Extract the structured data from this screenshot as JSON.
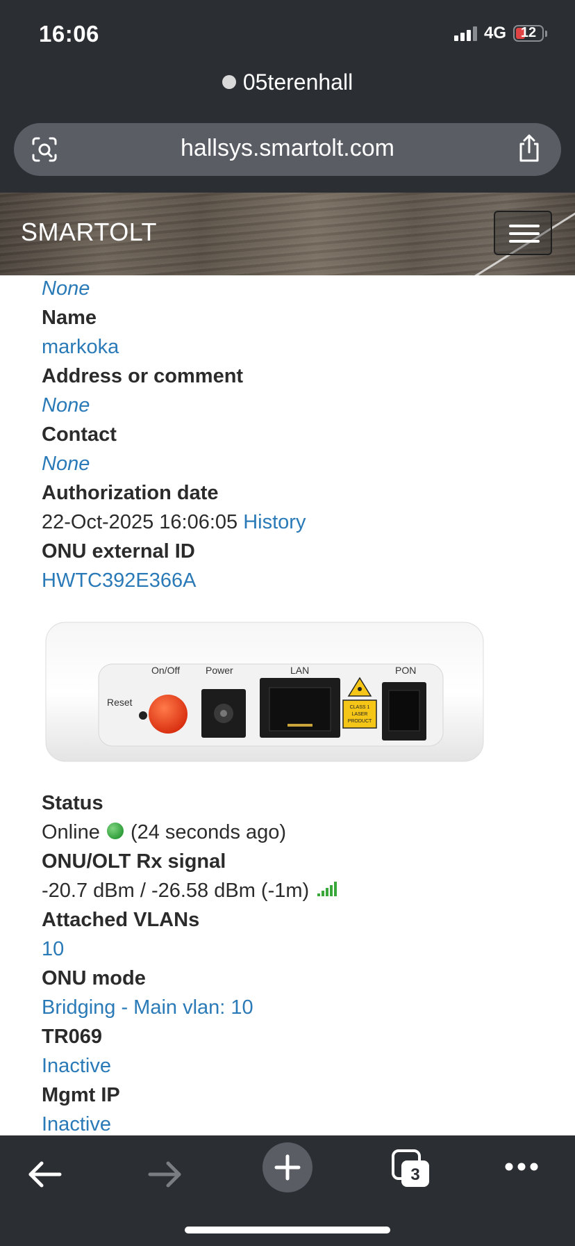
{
  "status_bar": {
    "time": "16:06",
    "network": "4G",
    "battery": "12"
  },
  "browser": {
    "site_name": "05terenhall",
    "url": "hallsys.smartolt.com",
    "tabs_count": "3"
  },
  "navbar": {
    "brand": "SMARTOLT"
  },
  "fields_top": {
    "prev_value": "None",
    "name_label": "Name",
    "name_value": "markoka",
    "address_label": "Address or comment",
    "address_value": "None",
    "contact_label": "Contact",
    "contact_value": "None",
    "auth_label": "Authorization date",
    "auth_value": "22-Oct-2025 16:06:05",
    "auth_history": "History",
    "ext_id_label": "ONU external ID",
    "ext_id_value": "HWTC392E366A"
  },
  "device_image": {
    "labels": {
      "reset": "Reset",
      "onoff": "On/Off",
      "power": "Power",
      "lan": "LAN",
      "pon": "PON",
      "laser": [
        "CLASS 1",
        "LASER",
        "PRODUCT"
      ]
    }
  },
  "fields_bottom": {
    "status_label": "Status",
    "status_value": "Online",
    "status_ago": "(24 seconds ago)",
    "rx_label": "ONU/OLT Rx signal",
    "rx_value": "-20.7 dBm / -26.58 dBm (-1m)",
    "vlans_label": "Attached VLANs",
    "vlans_value": "10",
    "mode_label": "ONU mode",
    "mode_value": "Bridging - Main vlan: 10",
    "tr069_label": "TR069",
    "tr069_value": "Inactive",
    "mgmt_label": "Mgmt IP",
    "mgmt_value": "Inactive"
  },
  "colors": {
    "link": "#2a7ab8",
    "chrome": "#2b2e33",
    "online": "#2f9e3a"
  }
}
